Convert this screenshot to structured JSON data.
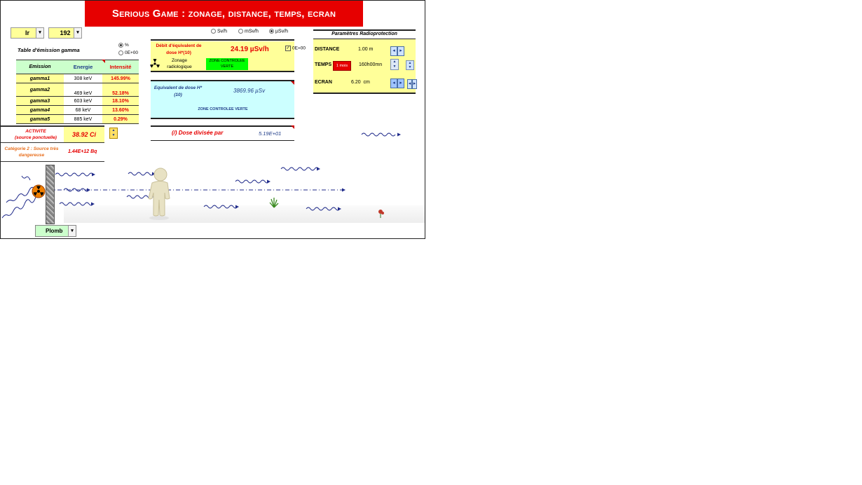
{
  "title": "Serious Game : zonage, distance, temps, ecran",
  "isotope": {
    "element": "Ir",
    "mass": "192"
  },
  "emission_table": {
    "title": "Table d'émission gamma",
    "toggle_percent": "%",
    "toggle_sci": "0E+00",
    "headers": [
      "Emission",
      "Energie",
      "Intensité"
    ],
    "rows": [
      {
        "name": "gamma1",
        "energy": "308 keV",
        "intensity": "145.99%"
      },
      {
        "name": "gamma2",
        "energy": "469 keV",
        "intensity": "52.18%"
      },
      {
        "name": "gamma3",
        "energy": "603 keV",
        "intensity": "18.10%"
      },
      {
        "name": "gamma4",
        "energy": "68 keV",
        "intensity": "13.60%"
      },
      {
        "name": "gamma5",
        "energy": "885 keV",
        "intensity": "0.29%"
      }
    ]
  },
  "activity": {
    "label": "ACTIVITE",
    "sublabel": "(source ponctuelle)",
    "value": "38.92 Ci"
  },
  "category": {
    "label": "Catégorie 2 : Source très dangereuse",
    "value": "1.44E+12 Bq"
  },
  "units": {
    "options": [
      "Sv/h",
      "mSv/h",
      "µSv/h"
    ],
    "selected": "µSv/h"
  },
  "dose_rate": {
    "label": "Débit d'équivalent de dose H*(10)",
    "value": "24.19 µSv/h",
    "sci_checkbox": "0E+00",
    "zonage_label": "Zonage radiologique",
    "zone_badge": "ZONE CONTROLEE VERTE"
  },
  "dose_equiv": {
    "label": "Equivalent de dose H*(10)",
    "value": "3869.96 µSv",
    "zone": "ZONE CONTROLEE VERTE"
  },
  "dose_divided": {
    "label": "(/) Dose divisée par",
    "value": "5.19E+01"
  },
  "params": {
    "title": "Paramètres Radioprotection",
    "distance_label": "DISTANCE",
    "distance_value": "1.00 m",
    "temps_label": "TEMPS",
    "temps_badge": "1 mois",
    "temps_value": "160h00mn",
    "ecran_label": "ECRAN",
    "ecran_value": "6.20  cm"
  },
  "shield_material": "Plomb",
  "colors": {
    "banner": "#e60000",
    "panel_yellow": "#ffff99",
    "panel_cyan": "#ccffff",
    "zone_green": "#00ff00",
    "wave_blue": "#1f2a8a"
  }
}
